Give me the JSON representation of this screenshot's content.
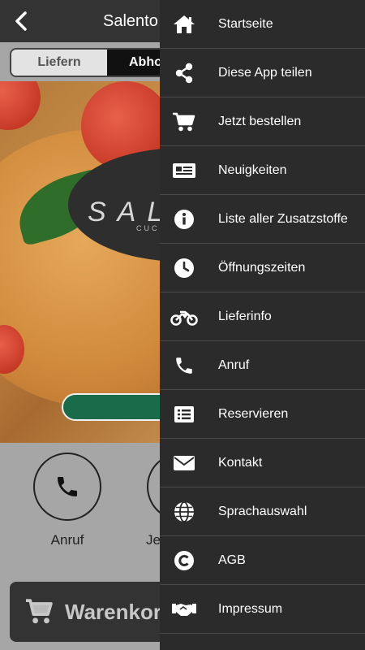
{
  "header": {
    "title": "Salento"
  },
  "order_mode": {
    "options": [
      "Liefern",
      "Abholen"
    ],
    "selected": "Abholen"
  },
  "hero": {
    "logo_text": "SALENTO",
    "logo_sub": "CUCINA"
  },
  "actions": [
    {
      "label": "Anruf",
      "icon": "phone-icon"
    },
    {
      "label": "Jetzt bestellen",
      "icon": "cart-icon"
    }
  ],
  "cart": {
    "label": "Warenkorb"
  },
  "drawer": {
    "items": [
      {
        "label": "Startseite",
        "icon": "home-icon"
      },
      {
        "label": "Diese App teilen",
        "icon": "share-icon"
      },
      {
        "label": "Jetzt bestellen",
        "icon": "cart-icon"
      },
      {
        "label": "Neuigkeiten",
        "icon": "newspaper-icon"
      },
      {
        "label": "Liste aller Zusatzstoffe",
        "icon": "info-icon"
      },
      {
        "label": "Öffnungszeiten",
        "icon": "clock-icon"
      },
      {
        "label": "Lieferinfo",
        "icon": "motorcycle-icon"
      },
      {
        "label": "Anruf",
        "icon": "phone-icon"
      },
      {
        "label": "Reservieren",
        "icon": "list-icon"
      },
      {
        "label": "Kontakt",
        "icon": "envelope-icon"
      },
      {
        "label": "Sprachauswahl",
        "icon": "globe-icon"
      },
      {
        "label": "AGB",
        "icon": "copyright-icon"
      },
      {
        "label": "Impressum",
        "icon": "handshake-icon"
      }
    ]
  },
  "colors": {
    "drawer_bg": "#2b2b2b",
    "topbar_bg": "#333333",
    "accent_green": "#1a6b4a"
  }
}
